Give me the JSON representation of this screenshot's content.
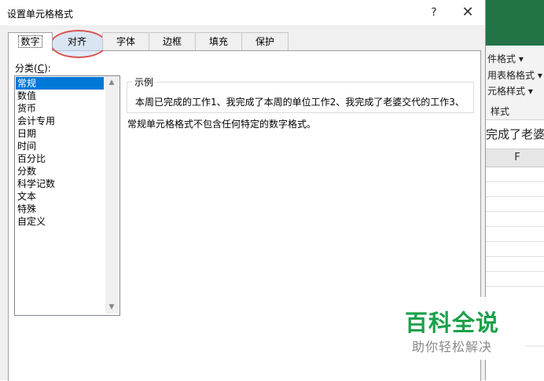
{
  "excel": {
    "ribbon_lines": [
      "件格式 ▾",
      "用表格格式 ▾",
      "元格样式 ▾",
      "样式"
    ],
    "formula_text": "完成了老婆",
    "column": "F"
  },
  "dialog": {
    "title": "设置单元格格式",
    "help": "?",
    "close": "✕",
    "tabs": [
      "数字",
      "对齐",
      "字体",
      "边框",
      "填充",
      "保护"
    ],
    "category_label_prefix": "分类(",
    "category_label_key": "C",
    "category_label_suffix": "):",
    "categories": [
      "常规",
      "数值",
      "货币",
      "会计专用",
      "日期",
      "时间",
      "百分比",
      "分数",
      "科学记数",
      "文本",
      "特殊",
      "自定义"
    ],
    "selected_category": "常规",
    "sample_label": "示例",
    "sample_text": "本周已完成的工作1、我完成了本周的单位工作2、我完成了老婆交代的工作3、",
    "description": "常规单元格格式不包含任何特定的数字格式。"
  },
  "watermark": {
    "title": "百科全说",
    "subtitle": "助你轻松解决"
  }
}
